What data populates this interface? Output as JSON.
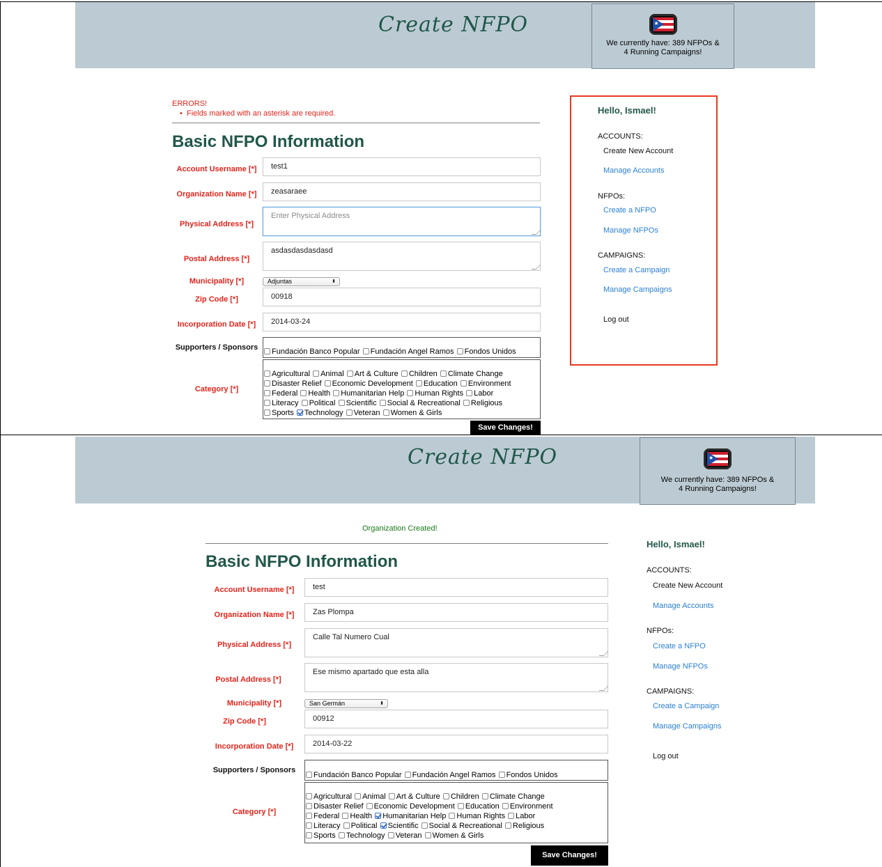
{
  "site": {
    "title": "Create NFPO",
    "stats_line1": "We currently have: 389 NFPOs &",
    "stats_line2": "4 Running Campaigns!"
  },
  "icons": {
    "flag": "puerto-rico-flag-icon"
  },
  "sidebar": {
    "hello": "Hello, Ismael!",
    "accounts_heading": "ACCOUNTS:",
    "create_account": "Create New Account",
    "manage_accounts": "Manage Accounts",
    "nfpos_heading": "NFPOs:",
    "create_nfpo": "Create a NFPO",
    "manage_nfpos": "Manage NFPOs",
    "campaigns_heading": "CAMPAIGNS:",
    "create_campaign": "Create a Campaign",
    "manage_campaigns": "Manage Campaigns",
    "logout": "Log out"
  },
  "labels": {
    "section_title": "Basic NFPO Information",
    "username": "Account Username [*]",
    "org_name": "Organization Name [*]",
    "physical": "Physical Address [*]",
    "postal": "Postal Address [*]",
    "municipality": "Municipality [*]",
    "zip": "Zip Code [*]",
    "incorporation": "Incorporation Date [*]",
    "supporters": "Supporters / Sponsors",
    "category": "Category [*]",
    "save": "Save Changes!"
  },
  "sponsors": [
    "Fundación Banco Popular",
    "Fundación Angel Ramos",
    "Fondos Unidos"
  ],
  "category_rows": [
    [
      "Agricultural",
      "Animal",
      "Art & Culture",
      "Children",
      "Climate Change"
    ],
    [
      "Disaster Relief",
      "Economic Development",
      "Education",
      "Environment"
    ],
    [
      "Federal",
      "Health",
      "Humanitarian Help",
      "Human Rights",
      "Labor"
    ],
    [
      "Literacy",
      "Political",
      "Scientific",
      "Social & Recreational",
      "Religious"
    ],
    [
      "Sports",
      "Technology",
      "Veteran",
      "Women & Girls"
    ]
  ],
  "panel_top": {
    "errors_title": "ERRORS!",
    "errors_item": "Fields marked with an asterisk are required.",
    "username": "test1",
    "org_name": "zeasaraee",
    "physical_placeholder": "Enter Physical Address",
    "postal": "asdasdasdasdasd",
    "municipality": "Adjuntas",
    "zip": "00918",
    "incorporation": "2014-03-24",
    "checked_categories": [
      "Technology"
    ]
  },
  "panel_bottom": {
    "success": "Organization Created!",
    "username": "test",
    "org_name": "Zas Plompa",
    "physical": "Calle Tal Numero Cual",
    "postal": "Ese mismo apartado que esta alla",
    "municipality": "San Germán",
    "zip": "00912",
    "incorporation": "2014-03-22",
    "checked_categories": [
      "Humanitarian Help",
      "Scientific"
    ]
  },
  "colors": {
    "header_bg": "#bccbd3",
    "title_green": "#21574a",
    "error_red": "#e5231b",
    "success_green": "#1b7a1b",
    "link_blue": "#2a7fd4",
    "highlight_box": "#e63a22"
  }
}
